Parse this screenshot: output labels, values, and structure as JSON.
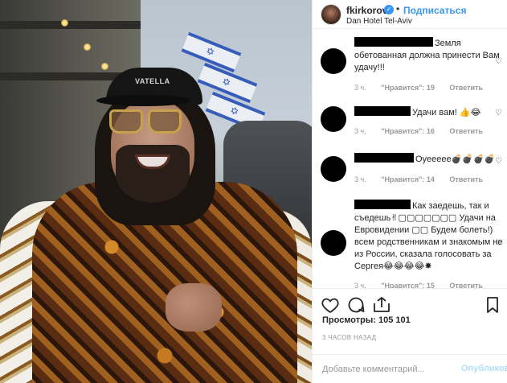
{
  "post": {
    "cap_text": "VATELLA"
  },
  "header": {
    "username": "fkirkorov",
    "separator": "•",
    "follow_label": "Подписаться",
    "location": "Dan Hotel Tel-Aviv"
  },
  "comments": [
    {
      "text": "Земля обетованная должна принести Вам удачу!!!",
      "time": "3 ч.",
      "likes": "\"Нравится\": 19",
      "reply": "Ответить"
    },
    {
      "text": "Удачи вам! 👍😂",
      "time": "3 ч.",
      "likes": "\"Нравится\": 16",
      "reply": "Ответить"
    },
    {
      "text": "Oyeeeee💣💣💣💣",
      "time": "3 ч.",
      "likes": "\"Нравится\": 14",
      "reply": "Ответить"
    },
    {
      "text": "Как заедешь, так и съедешь✌▢▢▢▢▢▢▢ Удачи на Евровидении ▢▢ Будем болеть!) всем родственникам и знакомым не из России, сказала голосовать за Сергея😂😂😂😂✸",
      "time": "3 ч.",
      "likes": "\"Нравится\": 15",
      "reply": "Ответить"
    }
  ],
  "stats": {
    "views_label": "Просмотры: 105 101",
    "time_ago": "3 ЧАСОВ НАЗАД"
  },
  "add_comment": {
    "placeholder": "Добавьте комментарий...",
    "publish_label": "Опубликовать"
  },
  "colors": {
    "link_blue": "#3897f0",
    "muted": "#999999",
    "border": "#efefef"
  },
  "icons": [
    "heart-icon",
    "comment-icon",
    "share-icon",
    "bookmark-icon",
    "verified-icon"
  ]
}
